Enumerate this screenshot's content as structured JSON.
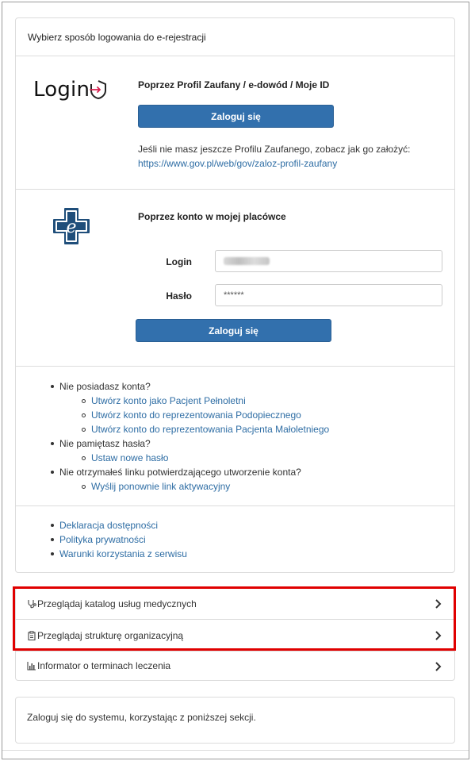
{
  "login_panel": {
    "header": "Wybierz sposób logowania do e-rejestracji",
    "profil": {
      "logo_text": "Login",
      "title": "Poprzez Profil Zaufany / e-dowód / Moje ID",
      "button_label": "Zaloguj się",
      "info_text": "Jeśli nie masz jeszcze Profilu Zaufanego, zobacz jak go założyć:",
      "info_link": "https://www.gov.pl/web/gov/zaloz-profil-zaufany"
    },
    "local": {
      "title": "Poprzez konto w mojej placówce",
      "login_label": "Login",
      "password_label": "Hasło",
      "password_value": "******",
      "button_label": "Zaloguj się"
    },
    "help": {
      "no_account": "Nie posiadasz konta?",
      "create_adult": "Utwórz konto jako Pacjent Pełnoletni",
      "create_ward": "Utwórz konto do reprezentowania Podopiecznego",
      "create_minor": "Utwórz konto do reprezentowania Pacjenta Małoletniego",
      "forgot_password": "Nie pamiętasz hasła?",
      "set_new_password": "Ustaw nowe hasło",
      "no_activation": "Nie otrzymałeś linku potwierdzającego utworzenie konta?",
      "resend_activation": "Wyślij ponownie link aktywacyjny"
    },
    "footer_links": {
      "accessibility": "Deklaracja dostępności",
      "privacy": "Polityka prywatności",
      "terms": "Warunki korzystania z serwisu"
    }
  },
  "nav_list": {
    "catalog": "Przeglądaj katalog usług medycznych",
    "structure": "Przeglądaj strukturę organizacyjną",
    "informator": "Informator o terminach leczenia"
  },
  "bottom_panel": {
    "text": "Zaloguj się do systemu, korzystając z poniższej sekcji."
  },
  "colors": {
    "primary_button": "#3270ad",
    "link": "#2e6da4",
    "highlight": "#e00000",
    "logo_arrow": "#d6204e"
  },
  "icons": [
    "login-shield-icon",
    "e-cross-logo-icon",
    "stethoscope-icon",
    "clipboard-icon",
    "bar-chart-icon",
    "chevron-right-icon"
  ]
}
